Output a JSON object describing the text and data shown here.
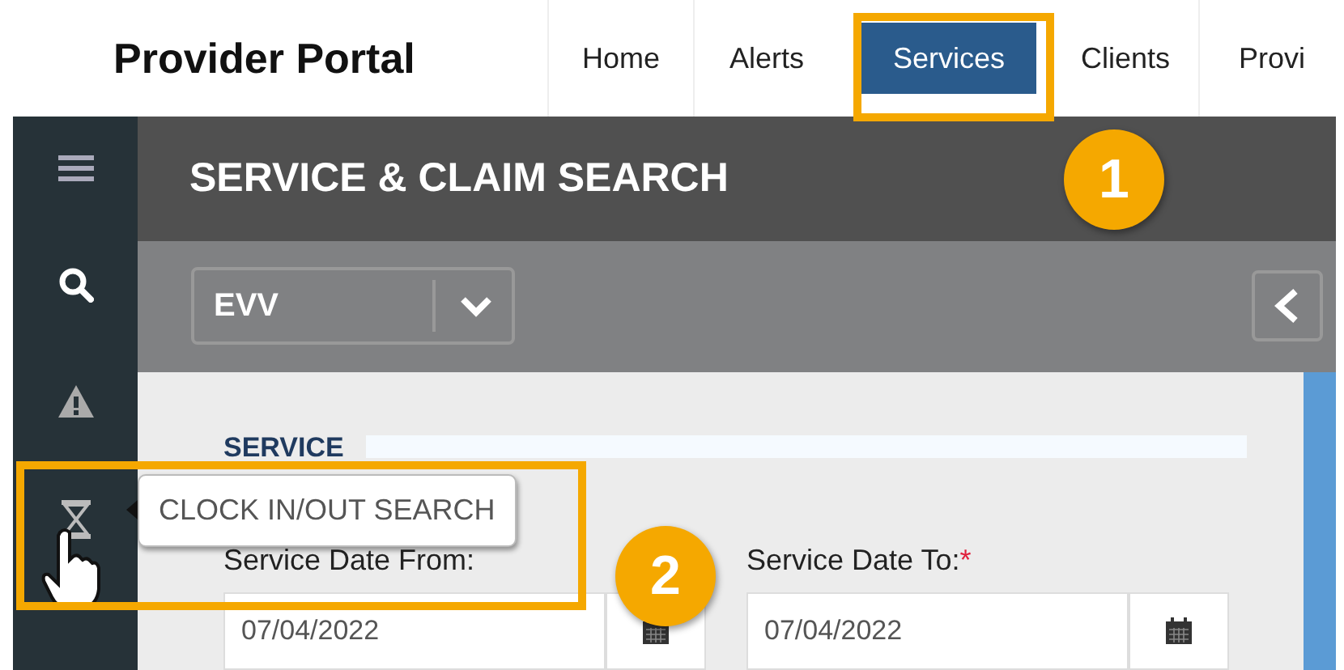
{
  "app": {
    "title": "Provider Portal"
  },
  "nav": [
    {
      "label": "Home",
      "selected": false
    },
    {
      "label": "Alerts",
      "selected": false
    },
    {
      "label": "Services",
      "selected": true
    },
    {
      "label": "Clients",
      "selected": false
    },
    {
      "label": "Provi",
      "selected": false
    }
  ],
  "sidebar": {
    "items": [
      {
        "kind": "menu"
      },
      {
        "kind": "search"
      },
      {
        "kind": "alert"
      },
      {
        "kind": "hourglass",
        "tooltip": "CLOCK IN/OUT SEARCH"
      }
    ]
  },
  "page": {
    "title": "SERVICE & CLAIM SEARCH",
    "filter": {
      "value": "EVV"
    },
    "section": "SERVICE",
    "fields": [
      {
        "label": "Service Date From:",
        "value": "07/04/2022"
      },
      {
        "label": "Service Date To:",
        "required_mark": "*",
        "value": "07/04/2022"
      }
    ]
  },
  "annotations": [
    {
      "label": "1"
    },
    {
      "label": "2"
    }
  ]
}
